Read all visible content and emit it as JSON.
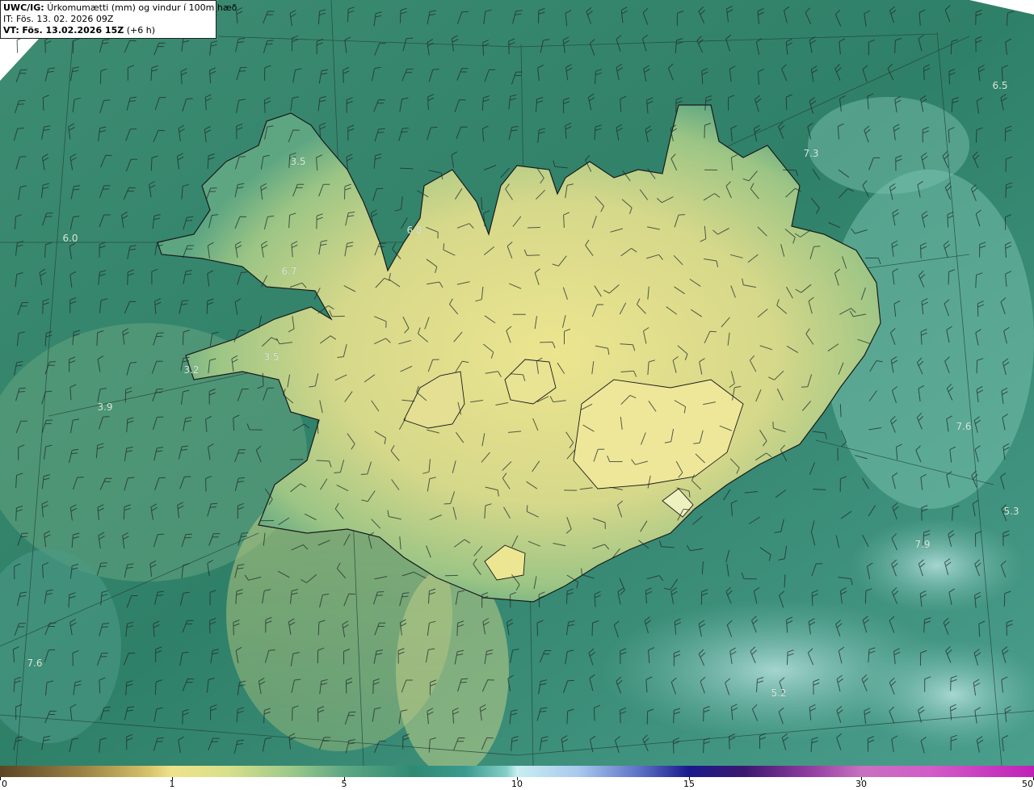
{
  "header": {
    "model": "UWC/IG:",
    "title": "Úrkomumætti (mm) og vindur í 100m hæð",
    "init_time": "IT: Fös. 13. 02. 2026 09Z",
    "valid_prefix": "VT:",
    "valid_time": "Fös. 13.02.2026 15Z",
    "lead": "(+6 h)"
  },
  "map": {
    "value_labels": [
      {
        "text": "6.5"
      },
      {
        "text": "7.3"
      },
      {
        "text": "3.5"
      },
      {
        "text": "6.8"
      },
      {
        "text": "6.0"
      },
      {
        "text": "6.7"
      },
      {
        "text": "3.5"
      },
      {
        "text": "3.2"
      },
      {
        "text": "3.9"
      },
      {
        "text": "7.6"
      },
      {
        "text": "5.3"
      },
      {
        "text": "7.9"
      },
      {
        "text": "7.6"
      },
      {
        "text": "5.2"
      }
    ]
  },
  "colorbar": {
    "ticks": [
      {
        "label": "0",
        "pos": 0.0
      },
      {
        "label": "1",
        "pos": 0.1666
      },
      {
        "label": "5",
        "pos": 0.3333
      },
      {
        "label": "10",
        "pos": 0.5
      },
      {
        "label": "15",
        "pos": 0.6666
      },
      {
        "label": "30",
        "pos": 0.8333
      },
      {
        "label": "50",
        "pos": 1.0
      }
    ]
  },
  "colors": {
    "sea_dark": "#1f6b58",
    "sea_mid": "#3f917c",
    "land_dry": "#e6de92",
    "coastline": "#1a1a1a",
    "barb": "#1f2b28",
    "label": "#d8ead8"
  }
}
